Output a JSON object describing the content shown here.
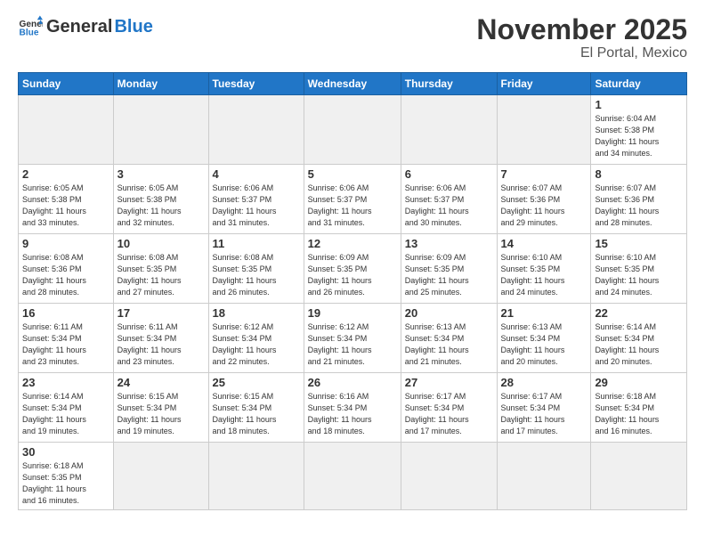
{
  "logo": {
    "general": "General",
    "blue": "Blue"
  },
  "header": {
    "month": "November 2025",
    "location": "El Portal, Mexico"
  },
  "weekdays": [
    "Sunday",
    "Monday",
    "Tuesday",
    "Wednesday",
    "Thursday",
    "Friday",
    "Saturday"
  ],
  "days": [
    {
      "num": "",
      "info": ""
    },
    {
      "num": "",
      "info": ""
    },
    {
      "num": "",
      "info": ""
    },
    {
      "num": "",
      "info": ""
    },
    {
      "num": "",
      "info": ""
    },
    {
      "num": "",
      "info": ""
    },
    {
      "num": "1",
      "info": "Sunrise: 6:04 AM\nSunset: 5:38 PM\nDaylight: 11 hours\nand 34 minutes."
    },
    {
      "num": "2",
      "info": "Sunrise: 6:05 AM\nSunset: 5:38 PM\nDaylight: 11 hours\nand 33 minutes."
    },
    {
      "num": "3",
      "info": "Sunrise: 6:05 AM\nSunset: 5:38 PM\nDaylight: 11 hours\nand 32 minutes."
    },
    {
      "num": "4",
      "info": "Sunrise: 6:06 AM\nSunset: 5:37 PM\nDaylight: 11 hours\nand 31 minutes."
    },
    {
      "num": "5",
      "info": "Sunrise: 6:06 AM\nSunset: 5:37 PM\nDaylight: 11 hours\nand 31 minutes."
    },
    {
      "num": "6",
      "info": "Sunrise: 6:06 AM\nSunset: 5:37 PM\nDaylight: 11 hours\nand 30 minutes."
    },
    {
      "num": "7",
      "info": "Sunrise: 6:07 AM\nSunset: 5:36 PM\nDaylight: 11 hours\nand 29 minutes."
    },
    {
      "num": "8",
      "info": "Sunrise: 6:07 AM\nSunset: 5:36 PM\nDaylight: 11 hours\nand 28 minutes."
    },
    {
      "num": "9",
      "info": "Sunrise: 6:08 AM\nSunset: 5:36 PM\nDaylight: 11 hours\nand 28 minutes."
    },
    {
      "num": "10",
      "info": "Sunrise: 6:08 AM\nSunset: 5:35 PM\nDaylight: 11 hours\nand 27 minutes."
    },
    {
      "num": "11",
      "info": "Sunrise: 6:08 AM\nSunset: 5:35 PM\nDaylight: 11 hours\nand 26 minutes."
    },
    {
      "num": "12",
      "info": "Sunrise: 6:09 AM\nSunset: 5:35 PM\nDaylight: 11 hours\nand 26 minutes."
    },
    {
      "num": "13",
      "info": "Sunrise: 6:09 AM\nSunset: 5:35 PM\nDaylight: 11 hours\nand 25 minutes."
    },
    {
      "num": "14",
      "info": "Sunrise: 6:10 AM\nSunset: 5:35 PM\nDaylight: 11 hours\nand 24 minutes."
    },
    {
      "num": "15",
      "info": "Sunrise: 6:10 AM\nSunset: 5:35 PM\nDaylight: 11 hours\nand 24 minutes."
    },
    {
      "num": "16",
      "info": "Sunrise: 6:11 AM\nSunset: 5:34 PM\nDaylight: 11 hours\nand 23 minutes."
    },
    {
      "num": "17",
      "info": "Sunrise: 6:11 AM\nSunset: 5:34 PM\nDaylight: 11 hours\nand 23 minutes."
    },
    {
      "num": "18",
      "info": "Sunrise: 6:12 AM\nSunset: 5:34 PM\nDaylight: 11 hours\nand 22 minutes."
    },
    {
      "num": "19",
      "info": "Sunrise: 6:12 AM\nSunset: 5:34 PM\nDaylight: 11 hours\nand 21 minutes."
    },
    {
      "num": "20",
      "info": "Sunrise: 6:13 AM\nSunset: 5:34 PM\nDaylight: 11 hours\nand 21 minutes."
    },
    {
      "num": "21",
      "info": "Sunrise: 6:13 AM\nSunset: 5:34 PM\nDaylight: 11 hours\nand 20 minutes."
    },
    {
      "num": "22",
      "info": "Sunrise: 6:14 AM\nSunset: 5:34 PM\nDaylight: 11 hours\nand 20 minutes."
    },
    {
      "num": "23",
      "info": "Sunrise: 6:14 AM\nSunset: 5:34 PM\nDaylight: 11 hours\nand 19 minutes."
    },
    {
      "num": "24",
      "info": "Sunrise: 6:15 AM\nSunset: 5:34 PM\nDaylight: 11 hours\nand 19 minutes."
    },
    {
      "num": "25",
      "info": "Sunrise: 6:15 AM\nSunset: 5:34 PM\nDaylight: 11 hours\nand 18 minutes."
    },
    {
      "num": "26",
      "info": "Sunrise: 6:16 AM\nSunset: 5:34 PM\nDaylight: 11 hours\nand 18 minutes."
    },
    {
      "num": "27",
      "info": "Sunrise: 6:17 AM\nSunset: 5:34 PM\nDaylight: 11 hours\nand 17 minutes."
    },
    {
      "num": "28",
      "info": "Sunrise: 6:17 AM\nSunset: 5:34 PM\nDaylight: 11 hours\nand 17 minutes."
    },
    {
      "num": "29",
      "info": "Sunrise: 6:18 AM\nSunset: 5:34 PM\nDaylight: 11 hours\nand 16 minutes."
    },
    {
      "num": "30",
      "info": "Sunrise: 6:18 AM\nSunset: 5:35 PM\nDaylight: 11 hours\nand 16 minutes."
    },
    {
      "num": "",
      "info": ""
    },
    {
      "num": "",
      "info": ""
    },
    {
      "num": "",
      "info": ""
    },
    {
      "num": "",
      "info": ""
    },
    {
      "num": "",
      "info": ""
    },
    {
      "num": "",
      "info": ""
    }
  ]
}
